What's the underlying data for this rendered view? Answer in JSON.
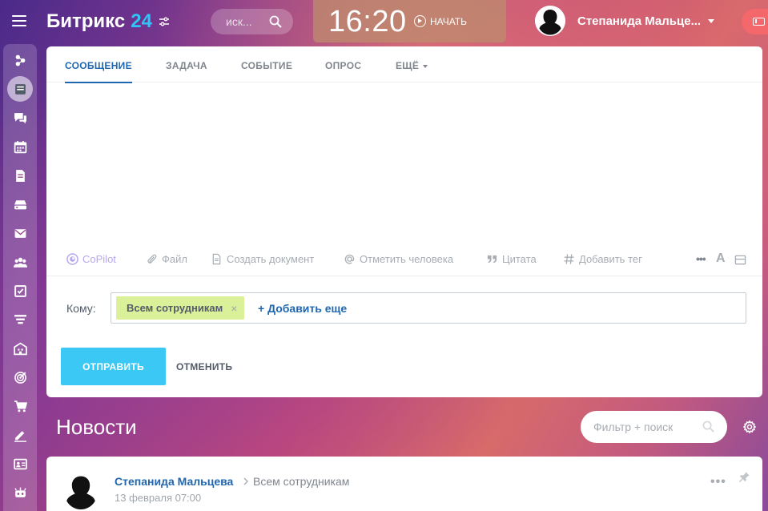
{
  "app": {
    "name": "Битрикс",
    "version": "24"
  },
  "search": {
    "placeholder": "иск..."
  },
  "timeman": {
    "time": "16:20",
    "start_label": "НАЧАТЬ"
  },
  "user": {
    "name": "Степанида Мальце..."
  },
  "sidebar": {
    "items": [
      {
        "icon": "sites-icon"
      },
      {
        "icon": "feed-icon",
        "active": true
      },
      {
        "icon": "chat-icon"
      },
      {
        "icon": "calendar-icon"
      },
      {
        "icon": "documents-icon"
      },
      {
        "icon": "drive-icon"
      },
      {
        "icon": "mail-icon"
      },
      {
        "icon": "groups-icon"
      },
      {
        "icon": "tasks-icon"
      },
      {
        "icon": "crm-funnel-icon"
      },
      {
        "icon": "company-icon"
      },
      {
        "icon": "marketing-target-icon"
      },
      {
        "icon": "shop-cart-icon"
      },
      {
        "icon": "signature-icon"
      },
      {
        "icon": "contacts-card-icon"
      },
      {
        "icon": "robot-icon"
      }
    ]
  },
  "composer": {
    "tabs": [
      {
        "label": "СООБЩЕНИЕ",
        "active": true
      },
      {
        "label": "ЗАДАЧА"
      },
      {
        "label": "СОБЫТИЕ"
      },
      {
        "label": "ОПРОС"
      },
      {
        "label": "ЕЩЁ"
      }
    ],
    "toolbar": {
      "copilot": "CoPilot",
      "file": "Файл",
      "create_doc": "Создать документ",
      "mention": "Отметить человека",
      "quote": "Цитата",
      "tag": "Добавить тег",
      "more": "•••",
      "format": "A"
    },
    "recipients": {
      "label": "Кому:",
      "chip": "Всем сотрудникам",
      "chip_remove": "×",
      "add_more": "+ Добавить еще"
    },
    "send_label": "ОТПРАВИТЬ",
    "cancel_label": "ОТМЕНИТЬ"
  },
  "news": {
    "title": "Новости",
    "filter_placeholder": "Фильтр + поиск",
    "posts": [
      {
        "author": "Степанида Мальцева",
        "destination": "Всем сотрудникам",
        "date": "13 февраля 07:00",
        "more": "•••"
      }
    ]
  },
  "colors": {
    "accent": "#2067b0",
    "send_button": "#3bc8f5",
    "chip": "#dbf199",
    "copilot": "#b9a7ef",
    "logo_number": "#2fc6f6"
  }
}
